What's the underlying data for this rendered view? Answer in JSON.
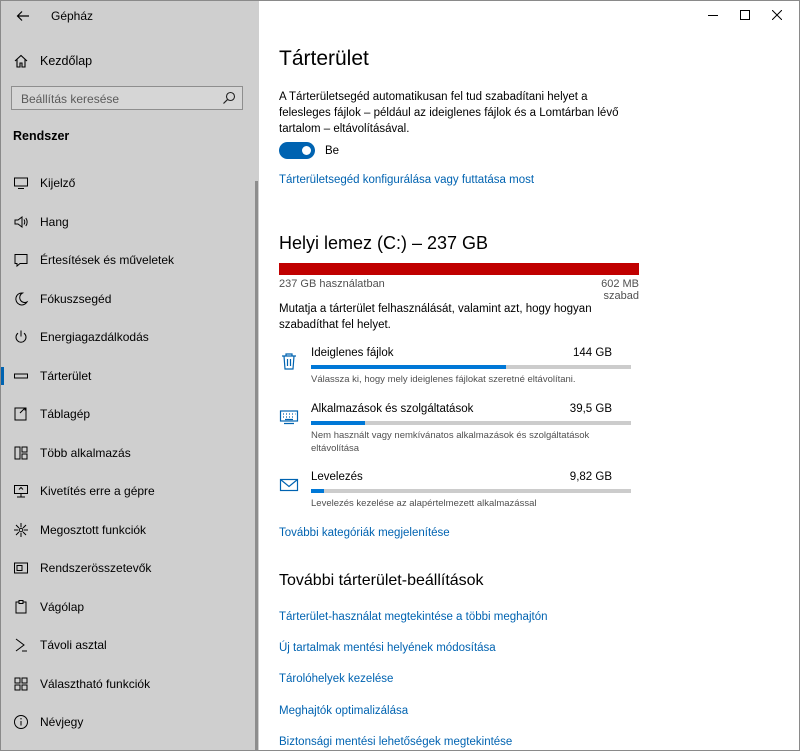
{
  "window": {
    "app_title": "Gépház"
  },
  "sidebar": {
    "home_label": "Kezdőlap",
    "search_placeholder": "Beállítás keresése",
    "section_label": "Rendszer",
    "items": [
      {
        "label": "Kijelző",
        "icon": "display-icon"
      },
      {
        "label": "Hang",
        "icon": "speaker-icon"
      },
      {
        "label": "Értesítések és műveletek",
        "icon": "notification-icon"
      },
      {
        "label": "Fókuszsegéd",
        "icon": "moon-icon"
      },
      {
        "label": "Energiagazdálkodás",
        "icon": "power-icon"
      },
      {
        "label": "Tárterület",
        "icon": "storage-icon",
        "active": true
      },
      {
        "label": "Táblagép",
        "icon": "tablet-icon"
      },
      {
        "label": "Több alkalmazás",
        "icon": "multitasking-icon"
      },
      {
        "label": "Kivetítés erre a gépre",
        "icon": "project-icon"
      },
      {
        "label": "Megosztott funkciók",
        "icon": "share-icon"
      },
      {
        "label": "Rendszerösszetevők",
        "icon": "components-icon"
      },
      {
        "label": "Vágólap",
        "icon": "clipboard-icon"
      },
      {
        "label": "Távoli asztal",
        "icon": "remote-icon"
      },
      {
        "label": "Választható funkciók",
        "icon": "features-icon"
      },
      {
        "label": "Névjegy",
        "icon": "info-icon"
      }
    ]
  },
  "main": {
    "title": "Tárterület",
    "storage_sense_desc": "A Tárterületsegéd automatikusan fel tud szabadítani helyet a felesleges fájlok – például az ideiglenes fájlok és a Lomtárban lévő tartalom – eltávolításával.",
    "toggle_state": "Be",
    "toggle_on": true,
    "configure_link": "Tárterületsegéd konfigurálása vagy futtatása most",
    "drive_title": "Helyi lemez (C:) – 237 GB",
    "drive_used": "237 GB használatban",
    "drive_free": "602 MB szabad",
    "drive_used_fraction": 0.997,
    "drive_bar_color": "#c00000",
    "usage_desc": "Mutatja a tárterület felhasználását, valamint azt, hogy hogyan szabadíthat fel helyet.",
    "categories": [
      {
        "name": "Ideiglenes fájlok",
        "size": "144 GB",
        "fraction": 0.61,
        "desc": "Válassza ki, hogy mely ideiglenes fájlokat szeretné eltávolítani.",
        "icon": "trash-icon"
      },
      {
        "name": "Alkalmazások és szolgáltatások",
        "size": "39,5 GB",
        "fraction": 0.17,
        "desc": "Nem használt vagy nemkívánatos alkalmazások és szolgáltatások eltávolítása",
        "icon": "keyboard-icon"
      },
      {
        "name": "Levelezés",
        "size": "9,82 GB",
        "fraction": 0.04,
        "desc": "Levelezés kezelése az alapértelmezett alkalmazással",
        "icon": "mail-icon"
      }
    ],
    "more_categories_link": "További kategóriák megjelenítése",
    "more_settings_title": "További tárterület-beállítások",
    "more_links": [
      "Tárterület-használat megtekintése a többi meghajtón",
      "Új tartalmak mentési helyének módosítása",
      "Tárolóhelyek kezelése",
      "Meghajtók optimalizálása",
      "Biztonsági mentési lehetőségek megtekintése"
    ],
    "accent_color": "#0063b1"
  }
}
